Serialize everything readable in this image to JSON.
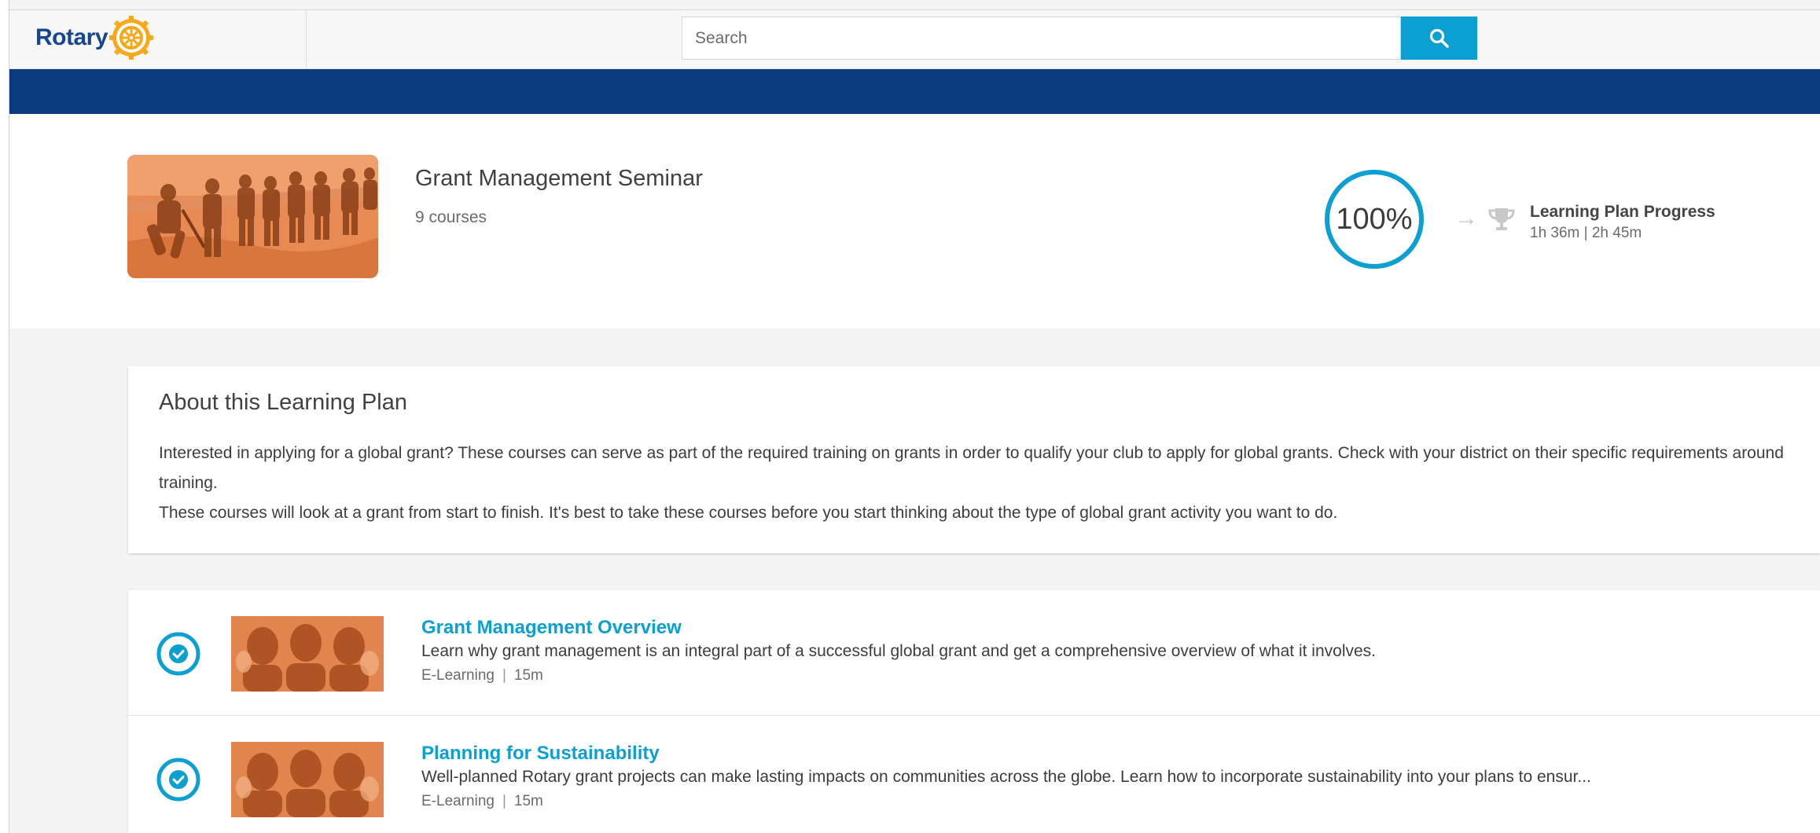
{
  "header": {
    "logo_text": "Rotary",
    "search_placeholder": "Search"
  },
  "plan": {
    "title": "Grant Management Seminar",
    "course_count": "9 courses",
    "progress_percent": 100,
    "progress_text": "100%",
    "progress_label": "Learning Plan Progress",
    "progress_time": "1h 36m | 2h 45m"
  },
  "about": {
    "title": "About this Learning Plan",
    "paragraph_1": "Interested in applying for a global grant? These courses can serve as part of the required training on grants in order to qualify your club to apply for global grants. Check with your district on their specific requirements around training.",
    "paragraph_2": "These courses will look at a grant from start to finish. It's best to take these courses before you start thinking about the type of global grant activity you want to do."
  },
  "courses": [
    {
      "title": "Grant Management Overview",
      "description": "Learn why grant management is an integral part of a successful global grant and get a comprehensive overview of what it involves.",
      "type": "E-Learning",
      "duration": "15m",
      "status_icon": "check-circle-icon"
    },
    {
      "title": "Planning for Sustainability",
      "description": "Well-planned Rotary grant projects can make lasting impacts on communities across the globe. Learn how to incorporate sustainability into your plans to ensur...",
      "type": "E-Learning",
      "duration": "15m",
      "status_icon": "check-circle-icon"
    }
  ],
  "colors": {
    "brand_blue": "#17458f",
    "nav_band": "#0c3b80",
    "accent": "#0c9fd2",
    "gold": "#f7a81b",
    "image_tint": "#e88a54"
  }
}
